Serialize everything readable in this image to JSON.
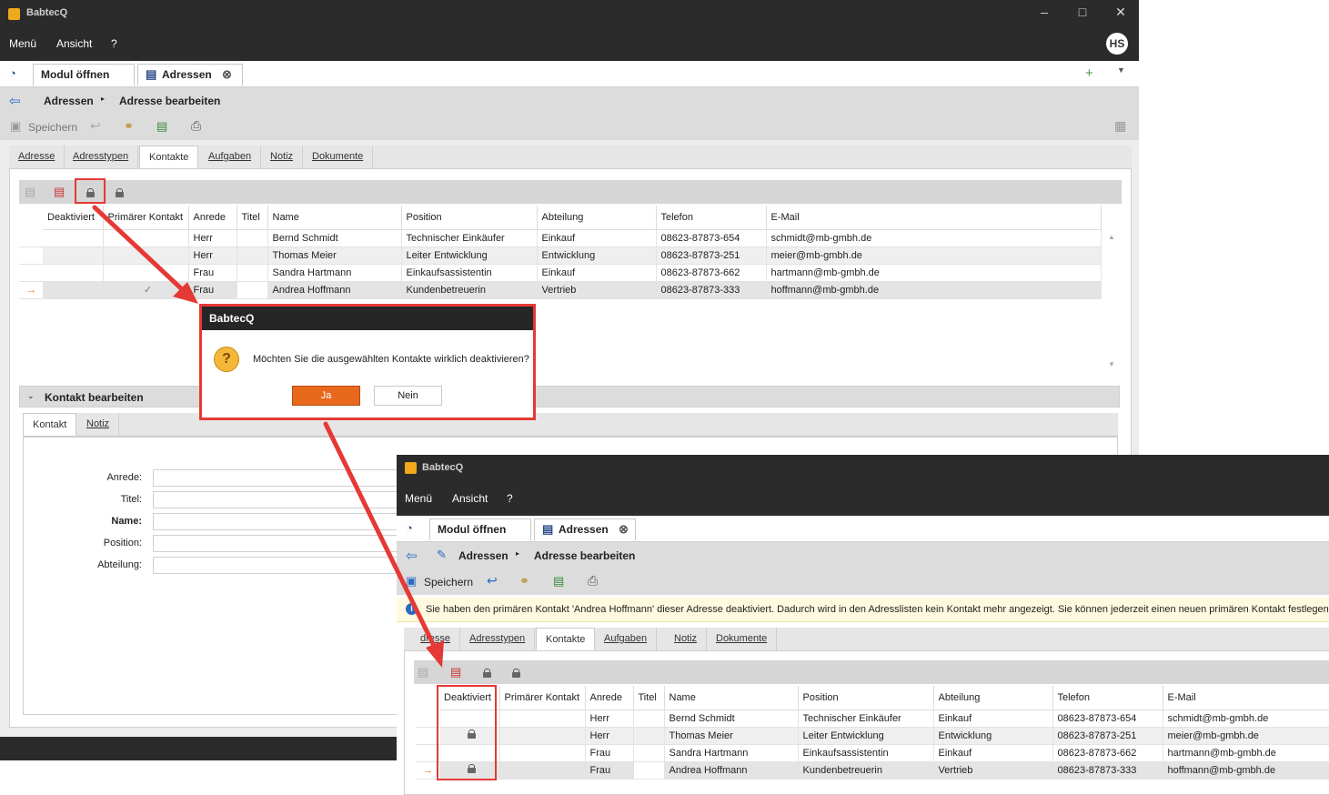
{
  "window1": {
    "app_title": "BabtecQ",
    "menu": [
      "Menü",
      "Ansicht",
      "?"
    ],
    "avatar": "HS",
    "tab_open_module": "Modul öffnen",
    "tab_addresses": "Adressen",
    "breadcrumb": [
      "Adressen",
      "Adresse bearbeiten"
    ],
    "save_label": "Speichern",
    "subtabs": [
      "Adresse",
      "Adresstypen",
      "Kontakte",
      "Aufgaben",
      "Notiz",
      "Dokumente"
    ],
    "columns": [
      "Deaktiviert",
      "Primärer Kontakt",
      "Anrede",
      "Titel",
      "Name",
      "Position",
      "Abteilung",
      "Telefon",
      "E-Mail"
    ],
    "rows": [
      {
        "anrede": "Herr",
        "name": "Bernd Schmidt",
        "position": "Technischer Einkäufer",
        "abteilung": "Einkauf",
        "telefon": "08623-87873-654",
        "email": "schmidt@mb-gmbh.de"
      },
      {
        "anrede": "Herr",
        "name": "Thomas Meier",
        "position": "Leiter Entwicklung",
        "abteilung": "Entwicklung",
        "telefon": "08623-87873-251",
        "email": "meier@mb-gmbh.de"
      },
      {
        "anrede": "Frau",
        "name": "Sandra Hartmann",
        "position": "Einkaufsassistentin",
        "abteilung": "Einkauf",
        "telefon": "08623-87873-662",
        "email": "hartmann@mb-gmbh.de"
      },
      {
        "anrede": "Frau",
        "name": "Andrea Hoffmann",
        "position": "Kundenbetreuerin",
        "abteilung": "Vertrieb",
        "telefon": "08623-87873-333",
        "email": "hoffmann@mb-gmbh.de"
      }
    ],
    "edit_section_title": "Kontakt bearbeiten",
    "edit_tabs": [
      "Kontakt",
      "Notiz"
    ],
    "form_labels": [
      "Anrede:",
      "Titel:",
      "Name:",
      "Position:",
      "Abteilung:"
    ]
  },
  "dialog": {
    "title": "BabtecQ",
    "message": "Möchten Sie die ausgewählten Kontakte wirklich deaktivieren?",
    "yes": "Ja",
    "no": "Nein"
  },
  "window2": {
    "app_title": "BabtecQ",
    "menu": [
      "Menü",
      "Ansicht",
      "?"
    ],
    "tab_open_module": "Modul öffnen",
    "tab_addresses": "Adressen",
    "breadcrumb": [
      "Adressen",
      "Adresse bearbeiten"
    ],
    "save_label": "Speichern",
    "info_text": "Sie haben den primären Kontakt 'Andrea Hoffmann' dieser Adresse deaktiviert. Dadurch wird in den Adresslisten kein Kontakt mehr angezeigt. Sie können jederzeit einen neuen primären Kontakt festlegen.",
    "subtabs": [
      "dresse",
      "Adresstypen",
      "Kontakte",
      "Aufgaben",
      "Notiz",
      "Dokumente"
    ],
    "columns": [
      "Deaktiviert",
      "Primärer Kontakt",
      "Anrede",
      "Titel",
      "Name",
      "Position",
      "Abteilung",
      "Telefon",
      "E-Mail"
    ]
  },
  "colors": {
    "accent": "#e8691c",
    "annotation": "#e53935",
    "titlebar": "#2b2b2b"
  }
}
